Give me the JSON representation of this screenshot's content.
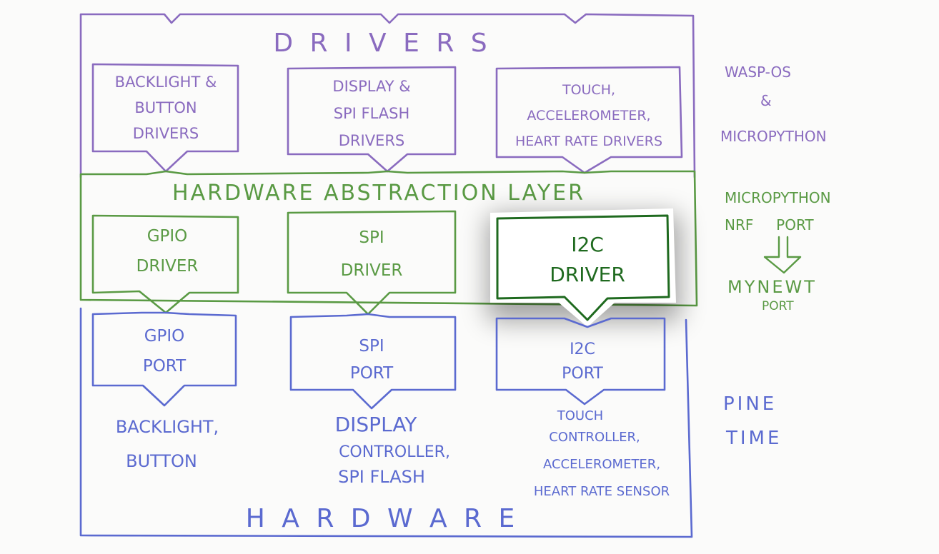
{
  "colors": {
    "drivers": "#8a6bbf",
    "hal": "#5a9a44",
    "highlight": "#1f6a1f",
    "hardware": "#5b6ad0",
    "background": "#fbfbfa"
  },
  "layers": {
    "drivers": {
      "title": "D R I V E R S",
      "boxes": [
        {
          "lines": [
            "BACKLIGHT &",
            "BUTTON",
            "DRIVERS"
          ]
        },
        {
          "lines": [
            "DISPLAY &",
            "SPI FLASH",
            "DRIVERS"
          ]
        },
        {
          "lines": [
            "TOUCH,",
            "ACCELEROMETER,",
            "HEART RATE DRIVERS"
          ]
        }
      ]
    },
    "hal": {
      "title": "HARDWARE ABSTRACTION LAYER",
      "boxes": [
        {
          "lines": [
            "GPIO",
            "DRIVER"
          ]
        },
        {
          "lines": [
            "SPI",
            "DRIVER"
          ]
        },
        {
          "lines": [
            "I2C",
            "DRIVER"
          ]
        }
      ]
    },
    "hardware": {
      "title": "H A R D W A R E",
      "boxes": [
        {
          "lines": [
            "GPIO",
            "PORT"
          ]
        },
        {
          "lines": [
            "SPI",
            "PORT"
          ]
        },
        {
          "lines": [
            "I2C",
            "PORT"
          ]
        }
      ],
      "devices": [
        {
          "lines": [
            "BACKLIGHT,",
            "BUTTON"
          ]
        },
        {
          "lines": [
            "DISPLAY",
            "CONTROLLER,",
            "SPI FLASH"
          ]
        },
        {
          "lines": [
            "TOUCH",
            "CONTROLLER,",
            "ACCELEROMETER,",
            "HEART RATE SENSOR"
          ]
        }
      ]
    }
  },
  "side_labels": {
    "drivers": [
      "WASP-OS",
      "&",
      "MICROPYTHON"
    ],
    "hal": [
      "MICROPYTHON",
      "NRF     PORT",
      "MYNEWT",
      "PORT"
    ],
    "hardware": [
      "PINE",
      "TIME"
    ]
  }
}
